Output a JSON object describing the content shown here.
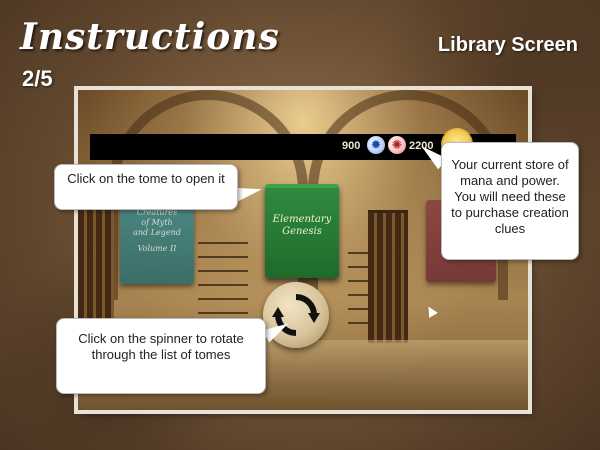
{
  "header": {
    "title": "Instructions",
    "page_indicator": "2/5",
    "screen_name": "Library Screen"
  },
  "game": {
    "mana_value": "900",
    "power_value": "2200",
    "mana_icon": "mana-orb-icon",
    "power_icon": "power-orb-icon",
    "tomes": {
      "left_title_lines": [
        "Creatures",
        "of Myth",
        "and Legend",
        "Volume II"
      ],
      "center_title_lines": [
        "Elementary",
        "Genesis"
      ]
    },
    "spinner_icon": "rotate-arrows-icon"
  },
  "callouts": {
    "tome": "Click on the tome to open it",
    "spinner": "Click on the spinner to rotate through the list of tomes",
    "mana": "Your current store of mana and power. You will need these to purchase creation clues"
  },
  "colors": {
    "parchment": "#6b4f33",
    "center_tome": "#2f8a3e",
    "left_tome": "#3e8a8c",
    "right_tome": "#8a3a40"
  }
}
